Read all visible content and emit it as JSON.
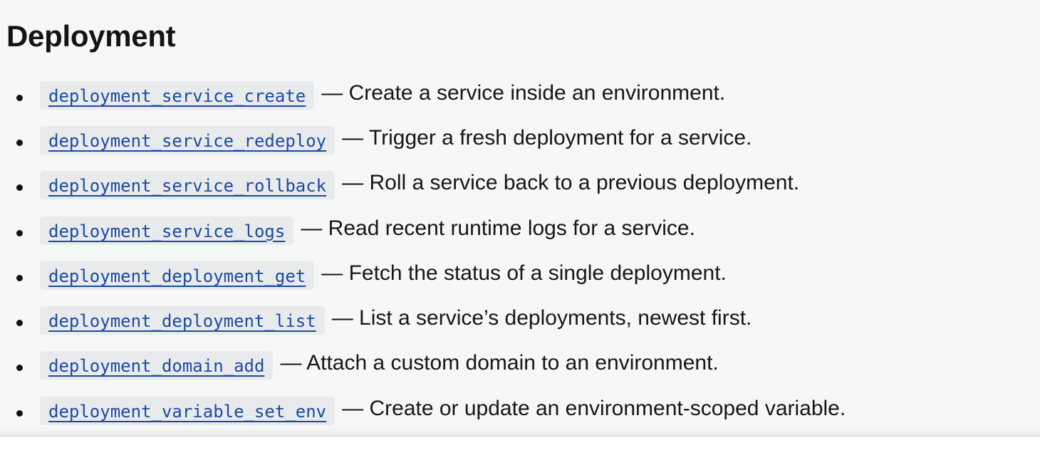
{
  "section": {
    "title": "Deployment"
  },
  "tools": [
    {
      "name": "deployment_service_create",
      "description": "— Create a service inside an environment."
    },
    {
      "name": "deployment_service_redeploy",
      "description": "— Trigger a fresh deployment for a service."
    },
    {
      "name": "deployment_service_rollback",
      "description": "— Roll a service back to a previous deployment."
    },
    {
      "name": "deployment_service_logs",
      "description": "— Read recent runtime logs for a service."
    },
    {
      "name": "deployment_deployment_get",
      "description": "— Fetch the status of a single deployment."
    },
    {
      "name": "deployment_deployment_list",
      "description": "— List a service’s deployments, newest first."
    },
    {
      "name": "deployment_domain_add",
      "description": "— Attach a custom domain to an environment."
    },
    {
      "name": "deployment_variable_set_env",
      "description": "— Create or update an environment-scoped variable."
    }
  ],
  "colors": {
    "panel_background": "#f6f7f7",
    "code_background": "#e8eaeb",
    "link": "#1b4ba3",
    "text": "#161616"
  }
}
